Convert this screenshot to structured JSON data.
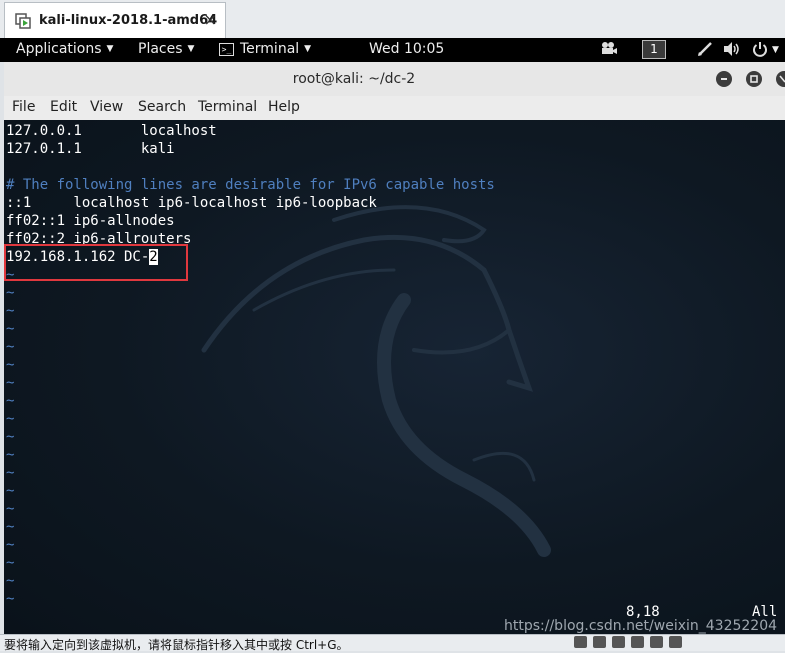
{
  "vm_tab": {
    "title": "kali-linux-2018.1-amd64",
    "close": "×"
  },
  "topbar": {
    "applications": "Applications",
    "places": "Places",
    "terminal": "Terminal",
    "clock": "Wed 10:05",
    "workspace": "1",
    "icons": [
      "video-icon",
      "pen-icon",
      "volume-icon",
      "power-icon"
    ]
  },
  "window": {
    "title": "root@kali: ~/dc-2",
    "buttons": [
      "minimize",
      "maximize",
      "close"
    ]
  },
  "menu": [
    "File",
    "Edit",
    "View",
    "Search",
    "Terminal",
    "Help"
  ],
  "terminal": {
    "lines": [
      "127.0.0.1       localhost",
      "127.0.1.1       kali",
      "",
      "# The following lines are desirable for IPv6 capable hosts",
      "::1     localhost ip6-localhost ip6-loopback",
      "ff02::1 ip6-allnodes",
      "ff02::2 ip6-allrouters"
    ],
    "edited_line_text": "192.168.1.162 DC-",
    "cursor_char": "2",
    "tilde_count": 19,
    "tilde": "~",
    "position": "8,18",
    "scroll": "All"
  },
  "watermark": "https://blog.csdn.net/weixin_43252204",
  "bottom_bar": {
    "text": "要将输入定向到该虚拟机，请将鼠标指针移入其中或按 Ctrl+G。"
  },
  "colors": {
    "highlight": "#e0383e",
    "comment": "#4f7fbf",
    "terminal_bg": "#0d1721"
  }
}
